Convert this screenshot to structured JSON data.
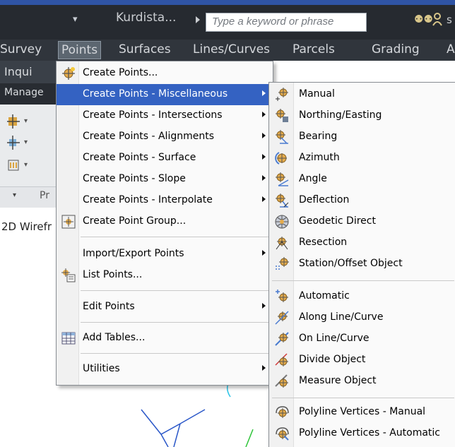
{
  "titlebar": {
    "quick_access_dropdown": "▾",
    "document_title": "Kurdista...",
    "search_placeholder": "Type a keyword or phrase",
    "trailing_text": "s"
  },
  "menubar": {
    "items": [
      "Survey",
      "Points",
      "Surfaces",
      "Lines/Curves",
      "Parcels",
      "Grading",
      "A"
    ],
    "active": "Points"
  },
  "ribbon": {
    "inquiry_label": "Inqui",
    "manage_label": "Manage",
    "panel_caret": "▾",
    "panel_label": "Pr"
  },
  "viewport": {
    "label": "2D Wirefr"
  },
  "points_menu": {
    "items": [
      {
        "label": "Create Points...",
        "icon": "create-points-icon",
        "submenu": false
      },
      {
        "label": "Create Points - Miscellaneous",
        "icon": "",
        "submenu": true,
        "highlighted": true
      },
      {
        "label": "Create Points - Intersections",
        "icon": "",
        "submenu": true
      },
      {
        "label": "Create Points - Alignments",
        "icon": "",
        "submenu": true
      },
      {
        "label": "Create Points - Surface",
        "icon": "",
        "submenu": true
      },
      {
        "label": "Create Points - Slope",
        "icon": "",
        "submenu": true
      },
      {
        "label": "Create Points - Interpolate",
        "icon": "",
        "submenu": true
      },
      {
        "label": "Create Point Group...",
        "icon": "point-group-icon",
        "submenu": false
      },
      {
        "label": "Import/Export Points",
        "icon": "",
        "submenu": true
      },
      {
        "label": "List Points...",
        "icon": "list-points-icon",
        "submenu": false
      },
      {
        "label": "Edit Points",
        "icon": "",
        "submenu": true
      },
      {
        "label": "Add Tables...",
        "icon": "table-icon",
        "submenu": false
      },
      {
        "label": "Utilities",
        "icon": "",
        "submenu": true
      }
    ]
  },
  "misc_submenu": {
    "items": [
      {
        "label": "Manual",
        "icon": "point-manual-icon"
      },
      {
        "label": "Northing/Easting",
        "icon": "northing-easting-icon"
      },
      {
        "label": "Bearing",
        "icon": "bearing-icon"
      },
      {
        "label": "Azimuth",
        "icon": "azimuth-icon"
      },
      {
        "label": "Angle",
        "icon": "angle-icon"
      },
      {
        "label": "Deflection",
        "icon": "deflection-icon"
      },
      {
        "label": "Geodetic Direct",
        "icon": "geodetic-direct-icon"
      },
      {
        "label": "Resection",
        "icon": "resection-icon"
      },
      {
        "label": "Station/Offset Object",
        "icon": "station-offset-icon"
      },
      {
        "label": "Automatic",
        "icon": "automatic-icon"
      },
      {
        "label": "Along Line/Curve",
        "icon": "along-line-curve-icon"
      },
      {
        "label": "On Line/Curve",
        "icon": "on-line-curve-icon"
      },
      {
        "label": "Divide Object",
        "icon": "divide-object-icon"
      },
      {
        "label": "Measure Object",
        "icon": "measure-object-icon"
      },
      {
        "label": "Polyline Vertices - Manual",
        "icon": "polyline-manual-icon"
      },
      {
        "label": "Polyline Vertices - Automatic",
        "icon": "polyline-automatic-icon"
      }
    ]
  },
  "colors": {
    "highlight": "#3462c2",
    "chrome_dark": "#262a30",
    "title_strip": "#2f54a5"
  }
}
